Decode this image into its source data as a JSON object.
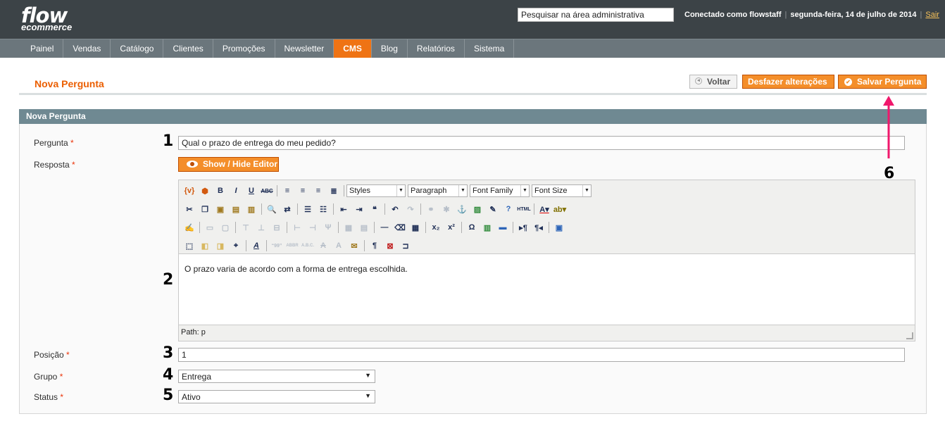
{
  "header": {
    "logo_line1": "flow",
    "logo_line2": "ecommerce",
    "search_value": "Pesquisar na área administrativa",
    "logged_in_as": "Conectado como flowstaff",
    "date": "segunda-feira, 14 de julho de 2014",
    "logout": "Sair"
  },
  "nav": {
    "items": [
      "Painel",
      "Vendas",
      "Catálogo",
      "Clientes",
      "Promoções",
      "Newsletter",
      "CMS",
      "Blog",
      "Relatórios",
      "Sistema"
    ],
    "active": "CMS"
  },
  "page": {
    "title": "Nova Pergunta",
    "buttons": {
      "back": "Voltar",
      "reset": "Desfazer alterações",
      "save": "Salvar Pergunta"
    }
  },
  "fieldset": {
    "legend": "Nova Pergunta",
    "required_mark": "*",
    "question": {
      "label": "Pergunta",
      "value": "Qual o prazo de entrega do meu pedido?"
    },
    "answer": {
      "label": "Resposta",
      "toggle_editor": "Show / Hide Editor",
      "toolbar_lists": {
        "styles": "Styles",
        "format": "Paragraph",
        "font_family": "Font Family",
        "font_size": "Font Size"
      },
      "content": "O prazo varia de acordo com a forma de entrega escolhida.",
      "path": "Path: p"
    },
    "position": {
      "label": "Posição",
      "value": "1"
    },
    "group": {
      "label": "Grupo",
      "value": "Entrega"
    },
    "status": {
      "label": "Status",
      "value": "Ativo"
    }
  },
  "annotations": {
    "n1": "1",
    "n2": "2",
    "n3": "3",
    "n4": "4",
    "n5": "5",
    "n6": "6"
  },
  "colors": {
    "accent": "#eb5e00",
    "button": "#f48e2a",
    "header_bg": "#3c4347",
    "nav_bg": "#6b767c",
    "fieldset_head": "#6f8992",
    "annotation_arrow": "#f0186c"
  }
}
